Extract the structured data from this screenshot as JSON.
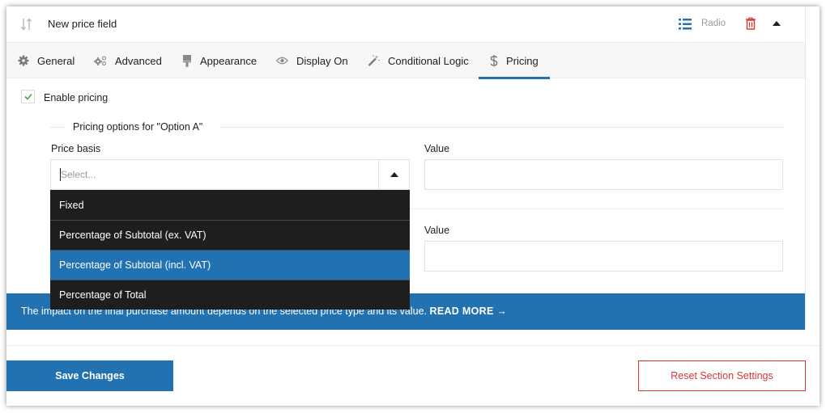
{
  "header": {
    "field_title": "New price field",
    "field_type": "Radio",
    "icons": {
      "sort": "sort-arrows-icon",
      "type": "list-icon",
      "delete": "trash-icon",
      "collapse": "chevron-up-icon"
    }
  },
  "tabs": [
    {
      "label": "General",
      "icon": "gear-icon",
      "active": false
    },
    {
      "label": "Advanced",
      "icon": "gears-icon",
      "active": false
    },
    {
      "label": "Appearance",
      "icon": "paint-roller-icon",
      "active": false
    },
    {
      "label": "Display On",
      "icon": "eye-icon",
      "active": false
    },
    {
      "label": "Conditional Logic",
      "icon": "magic-wand-icon",
      "active": false
    },
    {
      "label": "Pricing",
      "icon": "dollar-icon",
      "active": true
    }
  ],
  "pricing": {
    "enable_label": "Enable pricing",
    "enable_checked": true,
    "section_title": "Pricing options for \"Option A\"",
    "price_basis_label": "Price basis",
    "price_basis_placeholder": "Select...",
    "value_label": "Value",
    "value": "",
    "second_value_label": "Value",
    "second_value": "",
    "dropdown_open": true,
    "dropdown_options": [
      {
        "label": "Fixed",
        "highlighted": false
      },
      {
        "label": "Percentage of Subtotal (ex. VAT)",
        "highlighted": false
      },
      {
        "label": "Percentage of Subtotal (incl. VAT)",
        "highlighted": true
      },
      {
        "label": "Percentage of Total",
        "highlighted": false
      }
    ]
  },
  "info": {
    "text": "The impact on the final purchase amount depends on the selected price type and its value.",
    "read_more": "READ MORE →"
  },
  "footer": {
    "save_label": "Save Changes",
    "reset_label": "Reset Section Settings"
  },
  "colors": {
    "accent": "#2271b1",
    "danger": "#d63638",
    "check": "#3aa655",
    "dropdown_bg": "#1e1e1e"
  }
}
